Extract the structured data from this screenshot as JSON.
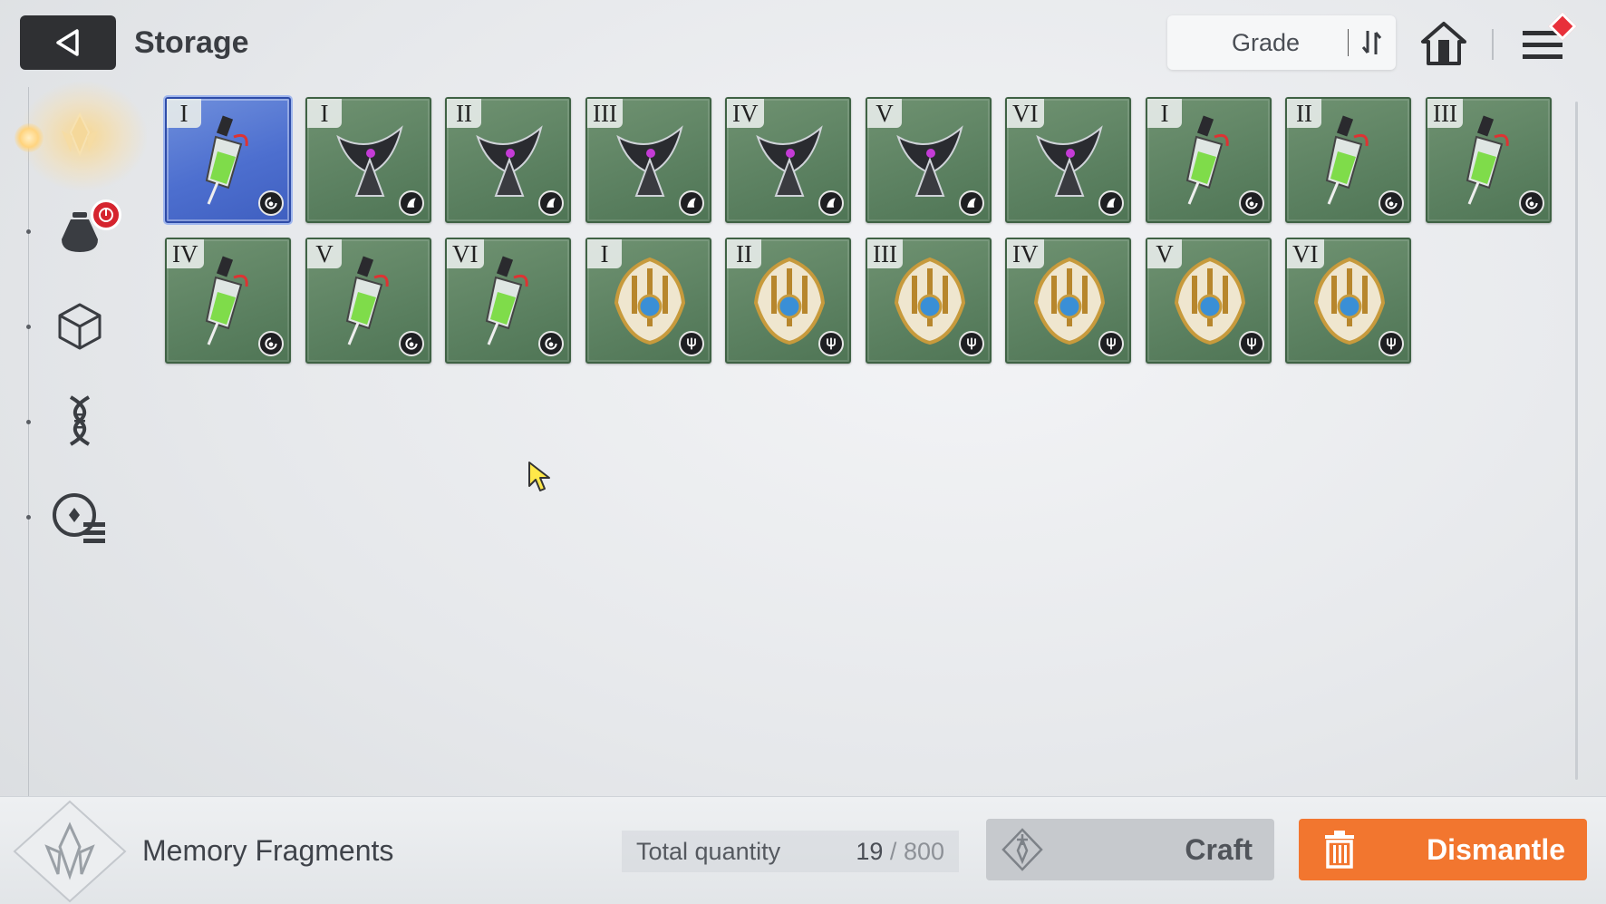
{
  "header": {
    "title": "Storage",
    "sort_label": "Grade"
  },
  "sidebar": {
    "tabs": [
      {
        "icon": "memory-fragment-icon",
        "active": true
      },
      {
        "icon": "consumable-pouch-icon",
        "active": false,
        "alert": true
      },
      {
        "icon": "cube-icon",
        "active": false
      },
      {
        "icon": "dna-helix-icon",
        "active": false
      },
      {
        "icon": "module-list-icon",
        "active": false
      }
    ]
  },
  "items": [
    {
      "grade": "I",
      "set": "syringe",
      "selected": true
    },
    {
      "grade": "I",
      "set": "dark-wing"
    },
    {
      "grade": "II",
      "set": "dark-wing"
    },
    {
      "grade": "III",
      "set": "dark-wing"
    },
    {
      "grade": "IV",
      "set": "dark-wing"
    },
    {
      "grade": "V",
      "set": "dark-wing"
    },
    {
      "grade": "VI",
      "set": "dark-wing"
    },
    {
      "grade": "I",
      "set": "syringe"
    },
    {
      "grade": "II",
      "set": "syringe"
    },
    {
      "grade": "III",
      "set": "syringe"
    },
    {
      "grade": "IV",
      "set": "syringe"
    },
    {
      "grade": "V",
      "set": "syringe"
    },
    {
      "grade": "VI",
      "set": "syringe"
    },
    {
      "grade": "I",
      "set": "gold-trident"
    },
    {
      "grade": "II",
      "set": "gold-trident"
    },
    {
      "grade": "III",
      "set": "gold-trident"
    },
    {
      "grade": "IV",
      "set": "gold-trident"
    },
    {
      "grade": "V",
      "set": "gold-trident"
    },
    {
      "grade": "VI",
      "set": "gold-trident"
    }
  ],
  "footer": {
    "category_title": "Memory Fragments",
    "quantity_label": "Total quantity",
    "quantity_current": "19",
    "quantity_sep": "/",
    "quantity_max": "800",
    "craft_label": "Craft",
    "dismantle_label": "Dismantle"
  },
  "colors": {
    "slot_green": "#5d8262",
    "slot_selected": "#4d6fcf",
    "dismantle_orange": "#f2762f",
    "alert_red": "#d5242e"
  }
}
